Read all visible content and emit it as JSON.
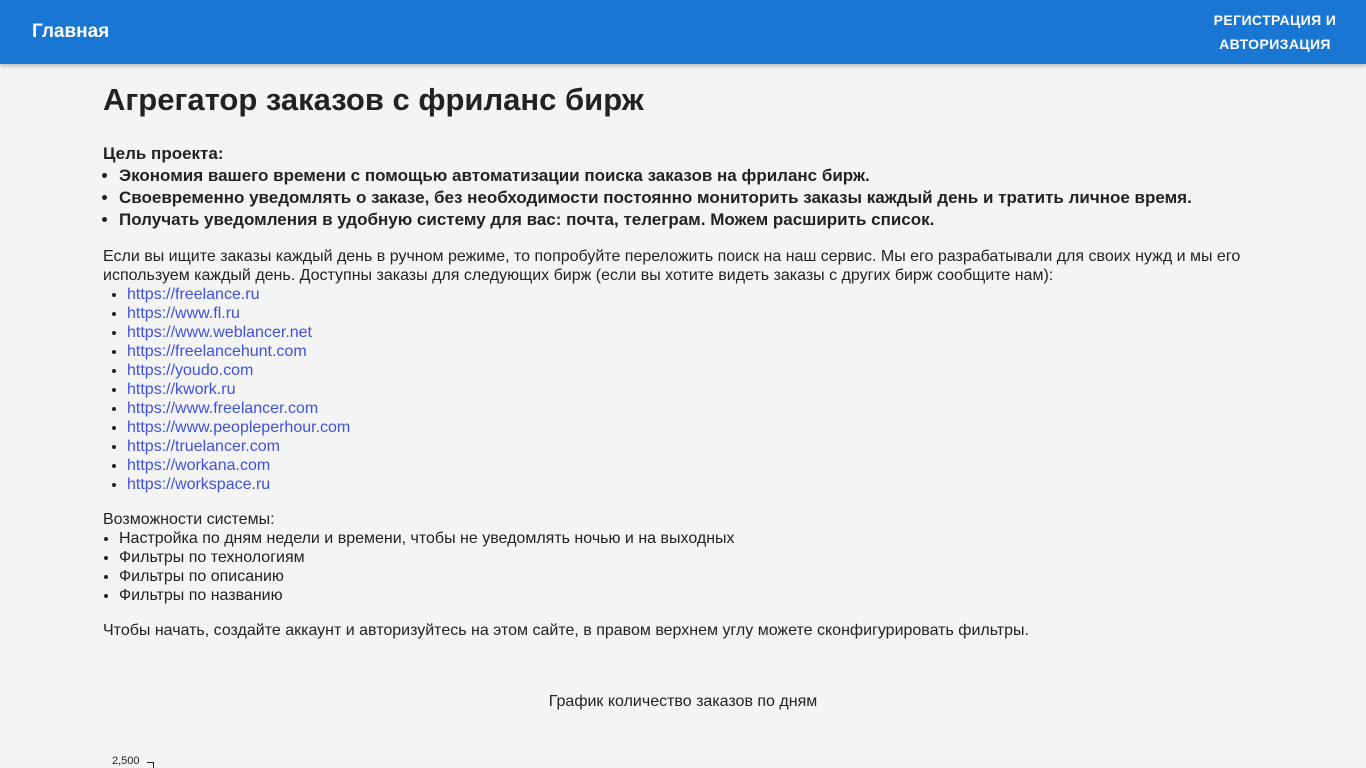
{
  "header": {
    "brand": "Главная",
    "auth_line1": "РЕГИСТРАЦИЯ И",
    "auth_line2": "АВТОРИЗАЦИЯ",
    "bg_color": "#1976d2"
  },
  "main": {
    "title": "Агрегатор заказов с фриланс бирж",
    "goal_title": "Цель проекта:",
    "goals": [
      "Экономия вашего времени с помощью автоматизации поиска заказов на фриланс бирж.",
      "Своевременно уведомлять о заказе, без необходимости постоянно мониторить заказы каждый день и тратить личное время.",
      "Получать уведомления в удобную систему для вас: почта, телеграм. Можем расширить список."
    ],
    "intro": "Если вы ищите заказы каждый день в ручном режиме, то попробуйте переложить поиск на наш сервис. Мы его разрабатывали для своих нужд и мы его используем каждый день. Доступны заказы для следующих бирж (если вы хотите видеть заказы с других бирж сообщите нам):",
    "sites": [
      "https://freelance.ru",
      "https://www.fl.ru",
      "https://www.weblancer.net",
      "https://freelancehunt.com",
      "https://youdo.com",
      "https://kwork.ru",
      "https://www.freelancer.com",
      "https://www.peopleperhour.com",
      "https://truelancer.com",
      "https://workana.com",
      "https://workspace.ru"
    ],
    "features_title": "Возможности системы:",
    "features": [
      "Настройка по дням недели и времени, чтобы не уведомлять ночью и на выходных",
      "Фильтры по технологиям",
      "Фильтры по описанию",
      "Фильтры по названию"
    ],
    "start_text": "Чтобы начать, создайте аккаунт и авторизуйтесь на этом сайте, в правом верхнем углу можете сконфигурировать фильтры.",
    "chart_title": "График количество заказов по дням",
    "chart_tick": "2,500",
    "link_color": "#3f51e0"
  }
}
